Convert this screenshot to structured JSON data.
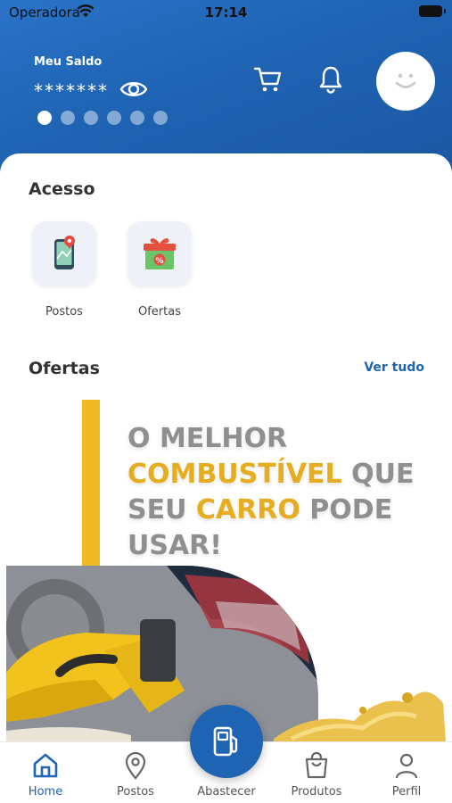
{
  "status_bar": {
    "carrier": "Operadora",
    "time": "17:14"
  },
  "balance": {
    "label": "Meu Saldo",
    "value": "*******"
  },
  "carousel": {
    "count": 6,
    "active_index": 0
  },
  "acesso": {
    "title": "Acesso",
    "items": [
      {
        "label": "Postos",
        "icon": "map-phone-icon"
      },
      {
        "label": "Ofertas",
        "icon": "gift-percent-icon"
      }
    ]
  },
  "ofertas": {
    "title": "Ofertas",
    "see_all": "Ver tudo",
    "banner": {
      "line1": "O MELHOR",
      "line2_highlight": "COMBUSTÍVEL",
      "line2_rest": " QUE",
      "line3_start": "SEU ",
      "line3_highlight": "CARRO",
      "line3_rest": " PODE",
      "line4": "USAR!"
    }
  },
  "bottom_nav": {
    "items": [
      {
        "label": "Home",
        "icon": "home-icon",
        "active": true
      },
      {
        "label": "Postos",
        "icon": "location-pin-icon",
        "active": false
      },
      {
        "label": "Abastecer",
        "icon": "fuel-pump-icon",
        "active": false
      },
      {
        "label": "Produtos",
        "icon": "shopping-bag-icon",
        "active": false
      },
      {
        "label": "Perfil",
        "icon": "person-icon",
        "active": false
      }
    ]
  },
  "colors": {
    "primary": "#1f63b3",
    "accent_yellow": "#efb825",
    "text_gray": "#8f8f8f"
  }
}
